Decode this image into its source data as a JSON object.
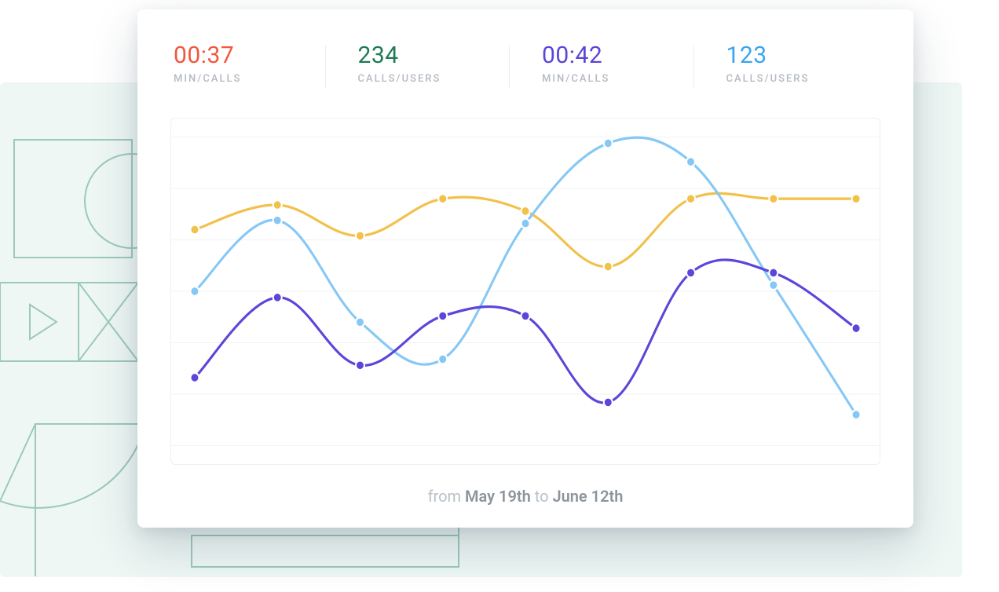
{
  "stats": [
    {
      "value": "00:37",
      "label": "MIN/CALLS",
      "color": "#f2573f"
    },
    {
      "value": "234",
      "label": "CALLS/USERS",
      "color": "#1f7a56"
    },
    {
      "value": "00:42",
      "label": "MIN/CALLS",
      "color": "#5b46d9"
    },
    {
      "value": "123",
      "label": "CALLS/USERS",
      "color": "#3aa4f0"
    }
  ],
  "caption": {
    "prefix": "from ",
    "start": "May 19th",
    "mid": " to ",
    "end": "June 12th"
  },
  "chart_data": {
    "type": "line",
    "title": "",
    "xlabel": "",
    "ylabel": "",
    "ylim": [
      0,
      100
    ],
    "x": [
      0,
      1,
      2,
      3,
      4,
      5,
      6,
      7,
      8
    ],
    "series": [
      {
        "name": "yellow",
        "color": "#f2c14b",
        "values": [
          70,
          78,
          68,
          80,
          76,
          58,
          80,
          80,
          80
        ]
      },
      {
        "name": "light-blue",
        "color": "#86c8f5",
        "values": [
          50,
          73,
          40,
          28,
          72,
          98,
          92,
          52,
          10
        ]
      },
      {
        "name": "purple",
        "color": "#5b46d9",
        "values": [
          22,
          48,
          26,
          42,
          42,
          14,
          56,
          56,
          38
        ]
      }
    ],
    "gridlines": 6
  }
}
